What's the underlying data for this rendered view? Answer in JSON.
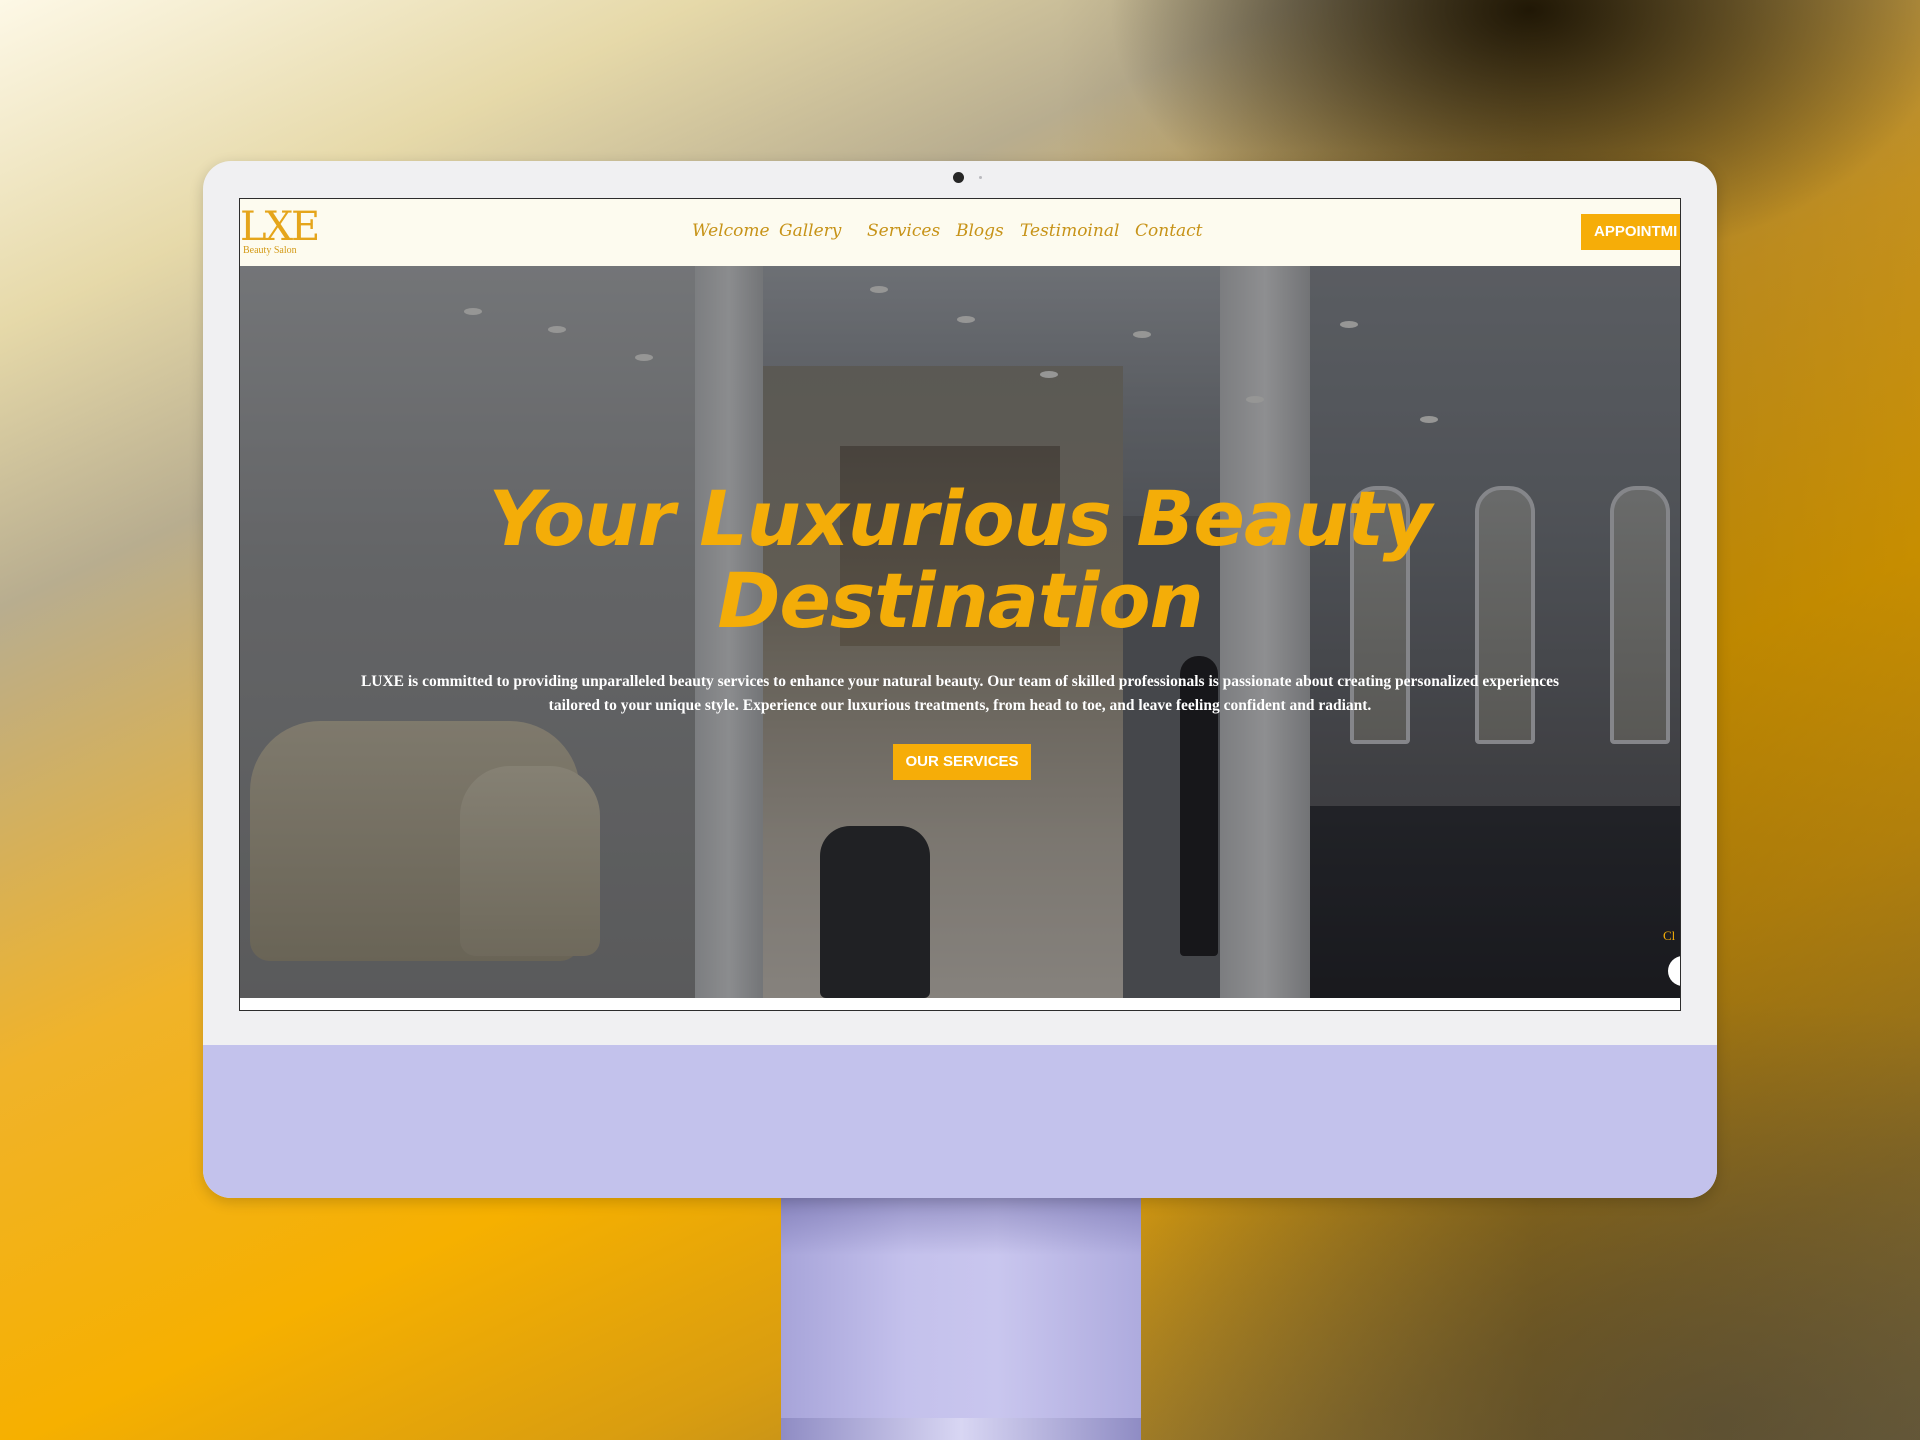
{
  "site": {
    "logo_text": "LXE",
    "logo_tagline": "Beauty Salon"
  },
  "nav": {
    "items": [
      {
        "label": "Welcome"
      },
      {
        "label": "Gallery"
      },
      {
        "label": "Services"
      },
      {
        "label": "Blogs"
      },
      {
        "label": "Testimoinal"
      },
      {
        "label": "Contact"
      }
    ],
    "cta_label": "APPOINTMI"
  },
  "hero": {
    "title": "Your Luxurious Beauty Destination",
    "description": "LUXE is committed to providing unparalleled beauty services to enhance your natural beauty. Our team of skilled professionals is passionate about creating personalized experiences tailored to your unique style. Experience our luxurious treatments, from head to toe, and leave feeling confident and radiant.",
    "button_label": "OUR SERVICES"
  },
  "chat": {
    "peek_text": "Cl"
  },
  "colors": {
    "accent": "#F6AD08",
    "nav_text": "#C79318",
    "nav_bg": "#FDFBEF",
    "monitor_chin": "#C3C2EC"
  }
}
